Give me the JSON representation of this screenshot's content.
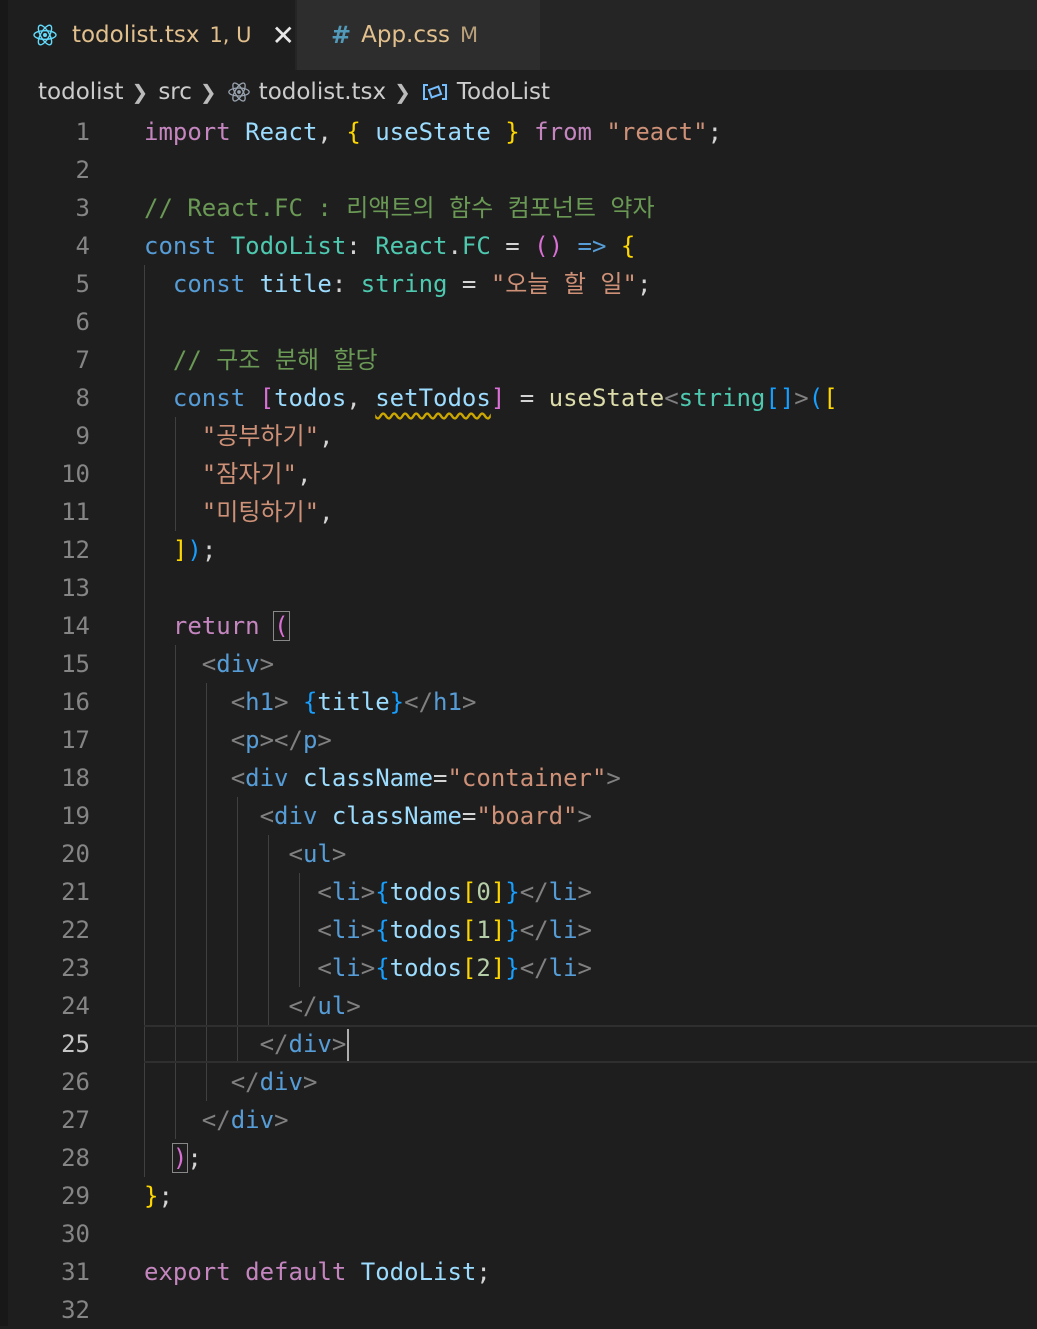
{
  "tabs": [
    {
      "name": "todolist.tsx",
      "badge": "1, U",
      "icon": "react-icon",
      "name_color": "#e2c08d",
      "active": true
    },
    {
      "name": "App.css",
      "badge": "M",
      "icon": "hash-icon",
      "name_color": "#e2c08d",
      "active": false
    }
  ],
  "breadcrumb": [
    "todolist",
    "src",
    "todolist.tsx",
    "TodoList"
  ],
  "editor": {
    "current_line": 25,
    "lines": [
      [
        [
          "kw",
          "import"
        ],
        [
          "tx",
          " "
        ],
        [
          "vr",
          "React"
        ],
        [
          "tx",
          ", "
        ],
        [
          "br1",
          "{"
        ],
        [
          "tx",
          " "
        ],
        [
          "vr",
          "useState"
        ],
        [
          "tx",
          " "
        ],
        [
          "br1",
          "}"
        ],
        [
          "tx",
          " "
        ],
        [
          "kw",
          "from"
        ],
        [
          "tx",
          " "
        ],
        [
          "str",
          "\"react\""
        ],
        [
          "tx",
          ";"
        ]
      ],
      [],
      [
        [
          "cm",
          "// React.FC : 리액트의 함수 컴포넌트 약자"
        ]
      ],
      [
        [
          "st",
          "const"
        ],
        [
          "tx",
          " "
        ],
        [
          "ty",
          "TodoList"
        ],
        [
          "tx",
          ": "
        ],
        [
          "ty",
          "React"
        ],
        [
          "tx",
          "."
        ],
        [
          "ty",
          "FC"
        ],
        [
          "tx",
          " = "
        ],
        [
          "br2",
          "()"
        ],
        [
          "tx",
          " "
        ],
        [
          "st",
          "=>"
        ],
        [
          "tx",
          " "
        ],
        [
          "br1",
          "{"
        ]
      ],
      [
        [
          "tx",
          "  "
        ],
        [
          "st",
          "const"
        ],
        [
          "tx",
          " "
        ],
        [
          "vr",
          "title"
        ],
        [
          "tx",
          ": "
        ],
        [
          "ty",
          "string"
        ],
        [
          "tx",
          " = "
        ],
        [
          "str",
          "\"오늘 할 일\""
        ],
        [
          "tx",
          ";"
        ]
      ],
      [],
      [
        [
          "tx",
          "  "
        ],
        [
          "cm",
          "// 구조 분해 할당"
        ]
      ],
      [
        [
          "tx",
          "  "
        ],
        [
          "st",
          "const"
        ],
        [
          "tx",
          " "
        ],
        [
          "br2",
          "["
        ],
        [
          "vr",
          "todos"
        ],
        [
          "tx",
          ", "
        ],
        [
          "vrsq",
          "setTodos"
        ],
        [
          "br2",
          "]"
        ],
        [
          "tx",
          " = "
        ],
        [
          "fn",
          "useState"
        ],
        [
          "pu",
          "<"
        ],
        [
          "ty",
          "string"
        ],
        [
          "br3",
          "[]"
        ],
        [
          "pu",
          ">"
        ],
        [
          "br3",
          "("
        ],
        [
          "br1",
          "["
        ]
      ],
      [
        [
          "tx",
          "    "
        ],
        [
          "str",
          "\"공부하기\""
        ],
        [
          "tx",
          ","
        ]
      ],
      [
        [
          "tx",
          "    "
        ],
        [
          "str",
          "\"잠자기\""
        ],
        [
          "tx",
          ","
        ]
      ],
      [
        [
          "tx",
          "    "
        ],
        [
          "str",
          "\"미팅하기\""
        ],
        [
          "tx",
          ","
        ]
      ],
      [
        [
          "tx",
          "  "
        ],
        [
          "br1",
          "]"
        ],
        [
          "br3",
          ")"
        ],
        [
          "tx",
          ";"
        ]
      ],
      [],
      [
        [
          "tx",
          "  "
        ],
        [
          "kw",
          "return"
        ],
        [
          "tx",
          " "
        ],
        [
          "br3m",
          "("
        ]
      ],
      [
        [
          "tx",
          "    "
        ],
        [
          "pu",
          "<"
        ],
        [
          "tg",
          "div"
        ],
        [
          "pu",
          ">"
        ]
      ],
      [
        [
          "tx",
          "      "
        ],
        [
          "pu",
          "<"
        ],
        [
          "tg",
          "h1"
        ],
        [
          "pu",
          ">"
        ],
        [
          "tx",
          " "
        ],
        [
          "br3",
          "{"
        ],
        [
          "vr",
          "title"
        ],
        [
          "br3",
          "}"
        ],
        [
          "pu",
          "</"
        ],
        [
          "tg",
          "h1"
        ],
        [
          "pu",
          ">"
        ]
      ],
      [
        [
          "tx",
          "      "
        ],
        [
          "pu",
          "<"
        ],
        [
          "tg",
          "p"
        ],
        [
          "pu",
          "></"
        ],
        [
          "tg",
          "p"
        ],
        [
          "pu",
          ">"
        ]
      ],
      [
        [
          "tx",
          "      "
        ],
        [
          "pu",
          "<"
        ],
        [
          "tg",
          "div"
        ],
        [
          "tx",
          " "
        ],
        [
          "vr",
          "className"
        ],
        [
          "tx",
          "="
        ],
        [
          "str",
          "\"container\""
        ],
        [
          "pu",
          ">"
        ]
      ],
      [
        [
          "tx",
          "        "
        ],
        [
          "pu",
          "<"
        ],
        [
          "tg",
          "div"
        ],
        [
          "tx",
          " "
        ],
        [
          "vr",
          "className"
        ],
        [
          "tx",
          "="
        ],
        [
          "str",
          "\"board\""
        ],
        [
          "pu",
          ">"
        ]
      ],
      [
        [
          "tx",
          "          "
        ],
        [
          "pu",
          "<"
        ],
        [
          "tg",
          "ul"
        ],
        [
          "pu",
          ">"
        ]
      ],
      [
        [
          "tx",
          "            "
        ],
        [
          "pu",
          "<"
        ],
        [
          "tg",
          "li"
        ],
        [
          "pu",
          ">"
        ],
        [
          "br3",
          "{"
        ],
        [
          "vr",
          "todos"
        ],
        [
          "br1",
          "["
        ],
        [
          "nm",
          "0"
        ],
        [
          "br1",
          "]"
        ],
        [
          "br3",
          "}"
        ],
        [
          "pu",
          "</"
        ],
        [
          "tg",
          "li"
        ],
        [
          "pu",
          ">"
        ]
      ],
      [
        [
          "tx",
          "            "
        ],
        [
          "pu",
          "<"
        ],
        [
          "tg",
          "li"
        ],
        [
          "pu",
          ">"
        ],
        [
          "br3",
          "{"
        ],
        [
          "vr",
          "todos"
        ],
        [
          "br1",
          "["
        ],
        [
          "nm",
          "1"
        ],
        [
          "br1",
          "]"
        ],
        [
          "br3",
          "}"
        ],
        [
          "pu",
          "</"
        ],
        [
          "tg",
          "li"
        ],
        [
          "pu",
          ">"
        ]
      ],
      [
        [
          "tx",
          "            "
        ],
        [
          "pu",
          "<"
        ],
        [
          "tg",
          "li"
        ],
        [
          "pu",
          ">"
        ],
        [
          "br3",
          "{"
        ],
        [
          "vr",
          "todos"
        ],
        [
          "br1",
          "["
        ],
        [
          "nm",
          "2"
        ],
        [
          "br1",
          "]"
        ],
        [
          "br3",
          "}"
        ],
        [
          "pu",
          "</"
        ],
        [
          "tg",
          "li"
        ],
        [
          "pu",
          ">"
        ]
      ],
      [
        [
          "tx",
          "          "
        ],
        [
          "pu",
          "</"
        ],
        [
          "tg",
          "ul"
        ],
        [
          "pu",
          ">"
        ]
      ],
      [
        [
          "tx",
          "        "
        ],
        [
          "pu",
          "</"
        ],
        [
          "tg",
          "div"
        ],
        [
          "pu",
          ">"
        ],
        [
          "caret",
          ""
        ]
      ],
      [
        [
          "tx",
          "      "
        ],
        [
          "pu",
          "</"
        ],
        [
          "tg",
          "div"
        ],
        [
          "pu",
          ">"
        ]
      ],
      [
        [
          "tx",
          "    "
        ],
        [
          "pu",
          "</"
        ],
        [
          "tg",
          "div"
        ],
        [
          "pu",
          ">"
        ]
      ],
      [
        [
          "tx",
          "  "
        ],
        [
          "br3m",
          ")"
        ],
        [
          "tx",
          ";"
        ]
      ],
      [
        [
          "br1",
          "}"
        ],
        [
          "tx",
          ";"
        ]
      ],
      [],
      [
        [
          "kw",
          "export"
        ],
        [
          "tx",
          " "
        ],
        [
          "kw",
          "default"
        ],
        [
          "tx",
          " "
        ],
        [
          "vr",
          "TodoList"
        ],
        [
          "tx",
          ";"
        ]
      ],
      []
    ]
  }
}
